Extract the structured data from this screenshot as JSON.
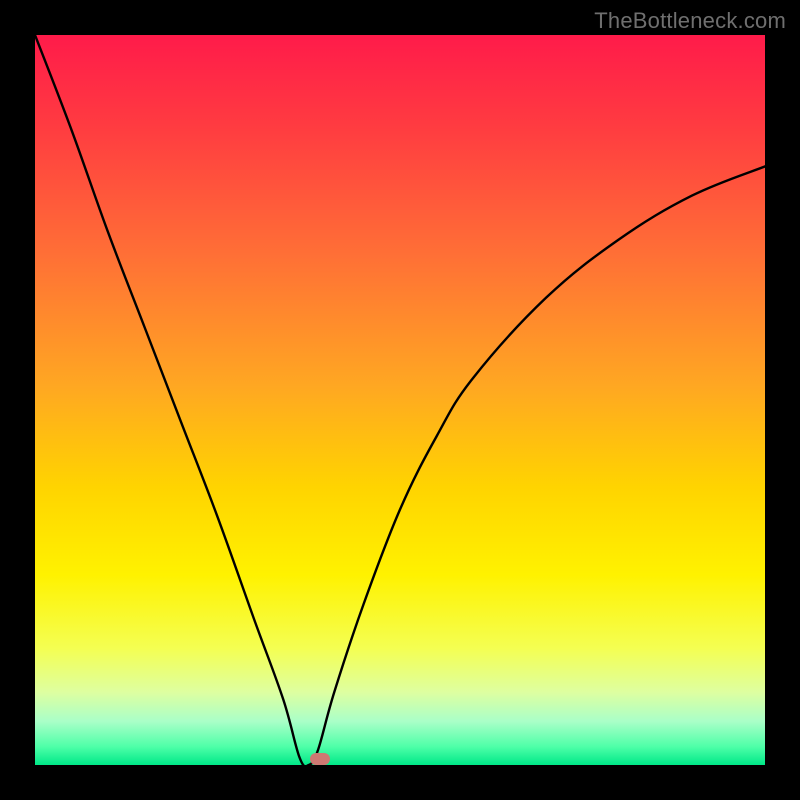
{
  "watermark": "TheBottleneck.com",
  "chart_data": {
    "type": "line",
    "title": "",
    "xlabel": "",
    "ylabel": "",
    "x_range_fraction": [
      0,
      1
    ],
    "y_range_percent": [
      0,
      100
    ],
    "minimum": {
      "x_fraction": 0.375,
      "y_percent": 0
    },
    "left_branch": [
      {
        "x_fraction": 0.0,
        "y_percent": 100
      },
      {
        "x_fraction": 0.05,
        "y_percent": 87
      },
      {
        "x_fraction": 0.1,
        "y_percent": 73
      },
      {
        "x_fraction": 0.15,
        "y_percent": 60
      },
      {
        "x_fraction": 0.2,
        "y_percent": 47
      },
      {
        "x_fraction": 0.25,
        "y_percent": 34
      },
      {
        "x_fraction": 0.3,
        "y_percent": 20
      },
      {
        "x_fraction": 0.34,
        "y_percent": 9
      },
      {
        "x_fraction": 0.3625,
        "y_percent": 1
      },
      {
        "x_fraction": 0.375,
        "y_percent": 0
      }
    ],
    "right_branch": [
      {
        "x_fraction": 0.375,
        "y_percent": 0
      },
      {
        "x_fraction": 0.3875,
        "y_percent": 2
      },
      {
        "x_fraction": 0.41,
        "y_percent": 10
      },
      {
        "x_fraction": 0.45,
        "y_percent": 22
      },
      {
        "x_fraction": 0.5,
        "y_percent": 35
      },
      {
        "x_fraction": 0.55,
        "y_percent": 45
      },
      {
        "x_fraction": 0.6,
        "y_percent": 53
      },
      {
        "x_fraction": 0.7,
        "y_percent": 64
      },
      {
        "x_fraction": 0.8,
        "y_percent": 72
      },
      {
        "x_fraction": 0.9,
        "y_percent": 78
      },
      {
        "x_fraction": 1.0,
        "y_percent": 82
      }
    ],
    "gradient_stops": [
      {
        "offset": 0.0,
        "color": "#ff1b4a"
      },
      {
        "offset": 0.12,
        "color": "#ff3a41"
      },
      {
        "offset": 0.3,
        "color": "#ff6f36"
      },
      {
        "offset": 0.48,
        "color": "#ffa722"
      },
      {
        "offset": 0.62,
        "color": "#ffd400"
      },
      {
        "offset": 0.74,
        "color": "#fff200"
      },
      {
        "offset": 0.84,
        "color": "#f4ff52"
      },
      {
        "offset": 0.9,
        "color": "#deffa0"
      },
      {
        "offset": 0.94,
        "color": "#aaffc8"
      },
      {
        "offset": 0.975,
        "color": "#4effa8"
      },
      {
        "offset": 1.0,
        "color": "#00e888"
      }
    ],
    "marker": {
      "x_fraction": 0.39,
      "y_fraction": 0.992,
      "color": "#ce7872"
    }
  }
}
